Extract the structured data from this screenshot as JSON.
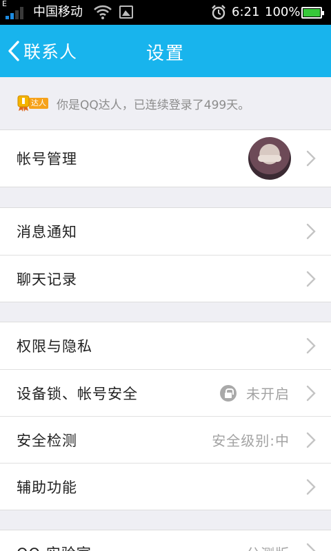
{
  "status_bar": {
    "indicator": "E",
    "carrier": "中国移动",
    "time": "6:21",
    "battery": "100%",
    "battery_level": 1.0,
    "icons": [
      "signal-icon",
      "wifi-icon",
      "gallery-icon",
      "alarm-icon",
      "battery-icon"
    ]
  },
  "header": {
    "back_label": "联系人",
    "title": "设置",
    "color": "#18b4ed"
  },
  "banner": {
    "badge_label": "达人",
    "text": "你是QQ达人，已连续登录了499天。"
  },
  "groups": {
    "account": {
      "label": "帐号管理"
    },
    "messages": [
      {
        "label": "消息通知"
      },
      {
        "label": "聊天记录"
      }
    ],
    "security": [
      {
        "label": "权限与隐私",
        "value": ""
      },
      {
        "label": "设备锁、帐号安全",
        "value": "未开启"
      },
      {
        "label": "安全检测",
        "value": "安全级别:中"
      },
      {
        "label": "辅助功能",
        "value": ""
      }
    ],
    "partial": {
      "label": "QQ 实验室",
      "value": "分测版"
    }
  }
}
